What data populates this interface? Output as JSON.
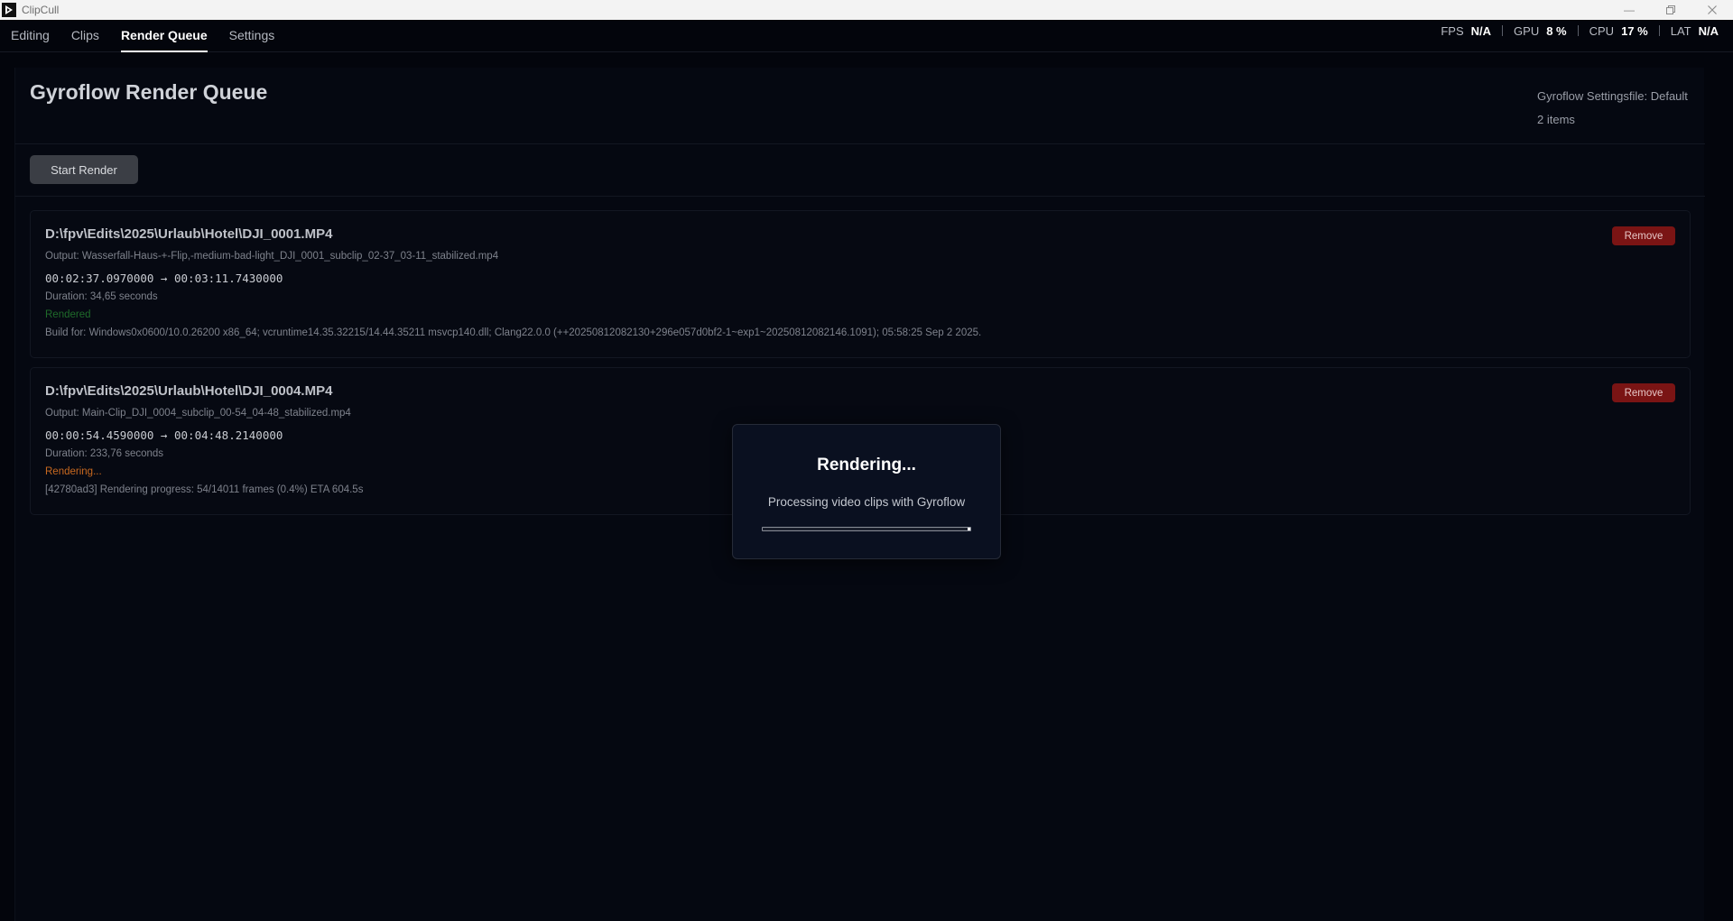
{
  "window": {
    "title": "ClipCull",
    "controls": [
      "minimize",
      "restore",
      "close"
    ]
  },
  "nav": {
    "tabs": [
      {
        "label": "Editing",
        "active": false
      },
      {
        "label": "Clips",
        "active": false
      },
      {
        "label": "Render Queue",
        "active": true
      },
      {
        "label": "Settings",
        "active": false
      }
    ],
    "stats": [
      {
        "label": "FPS",
        "value": "N/A"
      },
      {
        "label": "GPU",
        "value": "8 %"
      },
      {
        "label": "CPU",
        "value": "17 %"
      },
      {
        "label": "LAT",
        "value": "N/A"
      }
    ]
  },
  "header": {
    "title": "Gyroflow Render Queue",
    "settingsfile": "Gyroflow Settingsfile: Default",
    "item_count": "2 items"
  },
  "toolbar": {
    "start_label": "Start Render"
  },
  "queue": [
    {
      "path": "D:\\fpv\\Edits\\2025\\Urlaub\\Hotel\\DJI_0001.MP4",
      "output": "Output:  Wasserfall-Haus-+-Flip,-medium-bad-light_DJI_0001_subclip_02-37_03-11_stabilized.mp4",
      "times": "00:02:37.0970000  →  00:03:11.7430000",
      "duration": "Duration: 34,65 seconds",
      "status": "Rendered",
      "log": "Build for: Windows0x0600/10.0.26200 x86_64; vcruntime14.35.32215/14.44.35211 msvcp140.dll; Clang22.0.0 (++20250812082130+296e057d0bf2-1~exp1~20250812082146.1091); 05:58:25 Sep  2 2025.",
      "remove_label": "Remove"
    },
    {
      "path": "D:\\fpv\\Edits\\2025\\Urlaub\\Hotel\\DJI_0004.MP4",
      "output": "Output:  Main-Clip_DJI_0004_subclip_00-54_04-48_stabilized.mp4",
      "times": "00:00:54.4590000  →  00:04:48.2140000",
      "duration": "Duration: 233,76 seconds",
      "status": "Rendering...",
      "log": "[42780ad3] Rendering progress: 54/14011 frames (0.4%) ETA 604.5s",
      "remove_label": "Remove"
    }
  ],
  "modal": {
    "title": "Rendering...",
    "message": "Processing video clips with Gyroflow",
    "progress": 0.004
  },
  "colors": {
    "background": "#03050c",
    "remove_button": "#7a1414",
    "status_rendered": "#1f6b2a",
    "status_rendering": "#c9691f"
  }
}
